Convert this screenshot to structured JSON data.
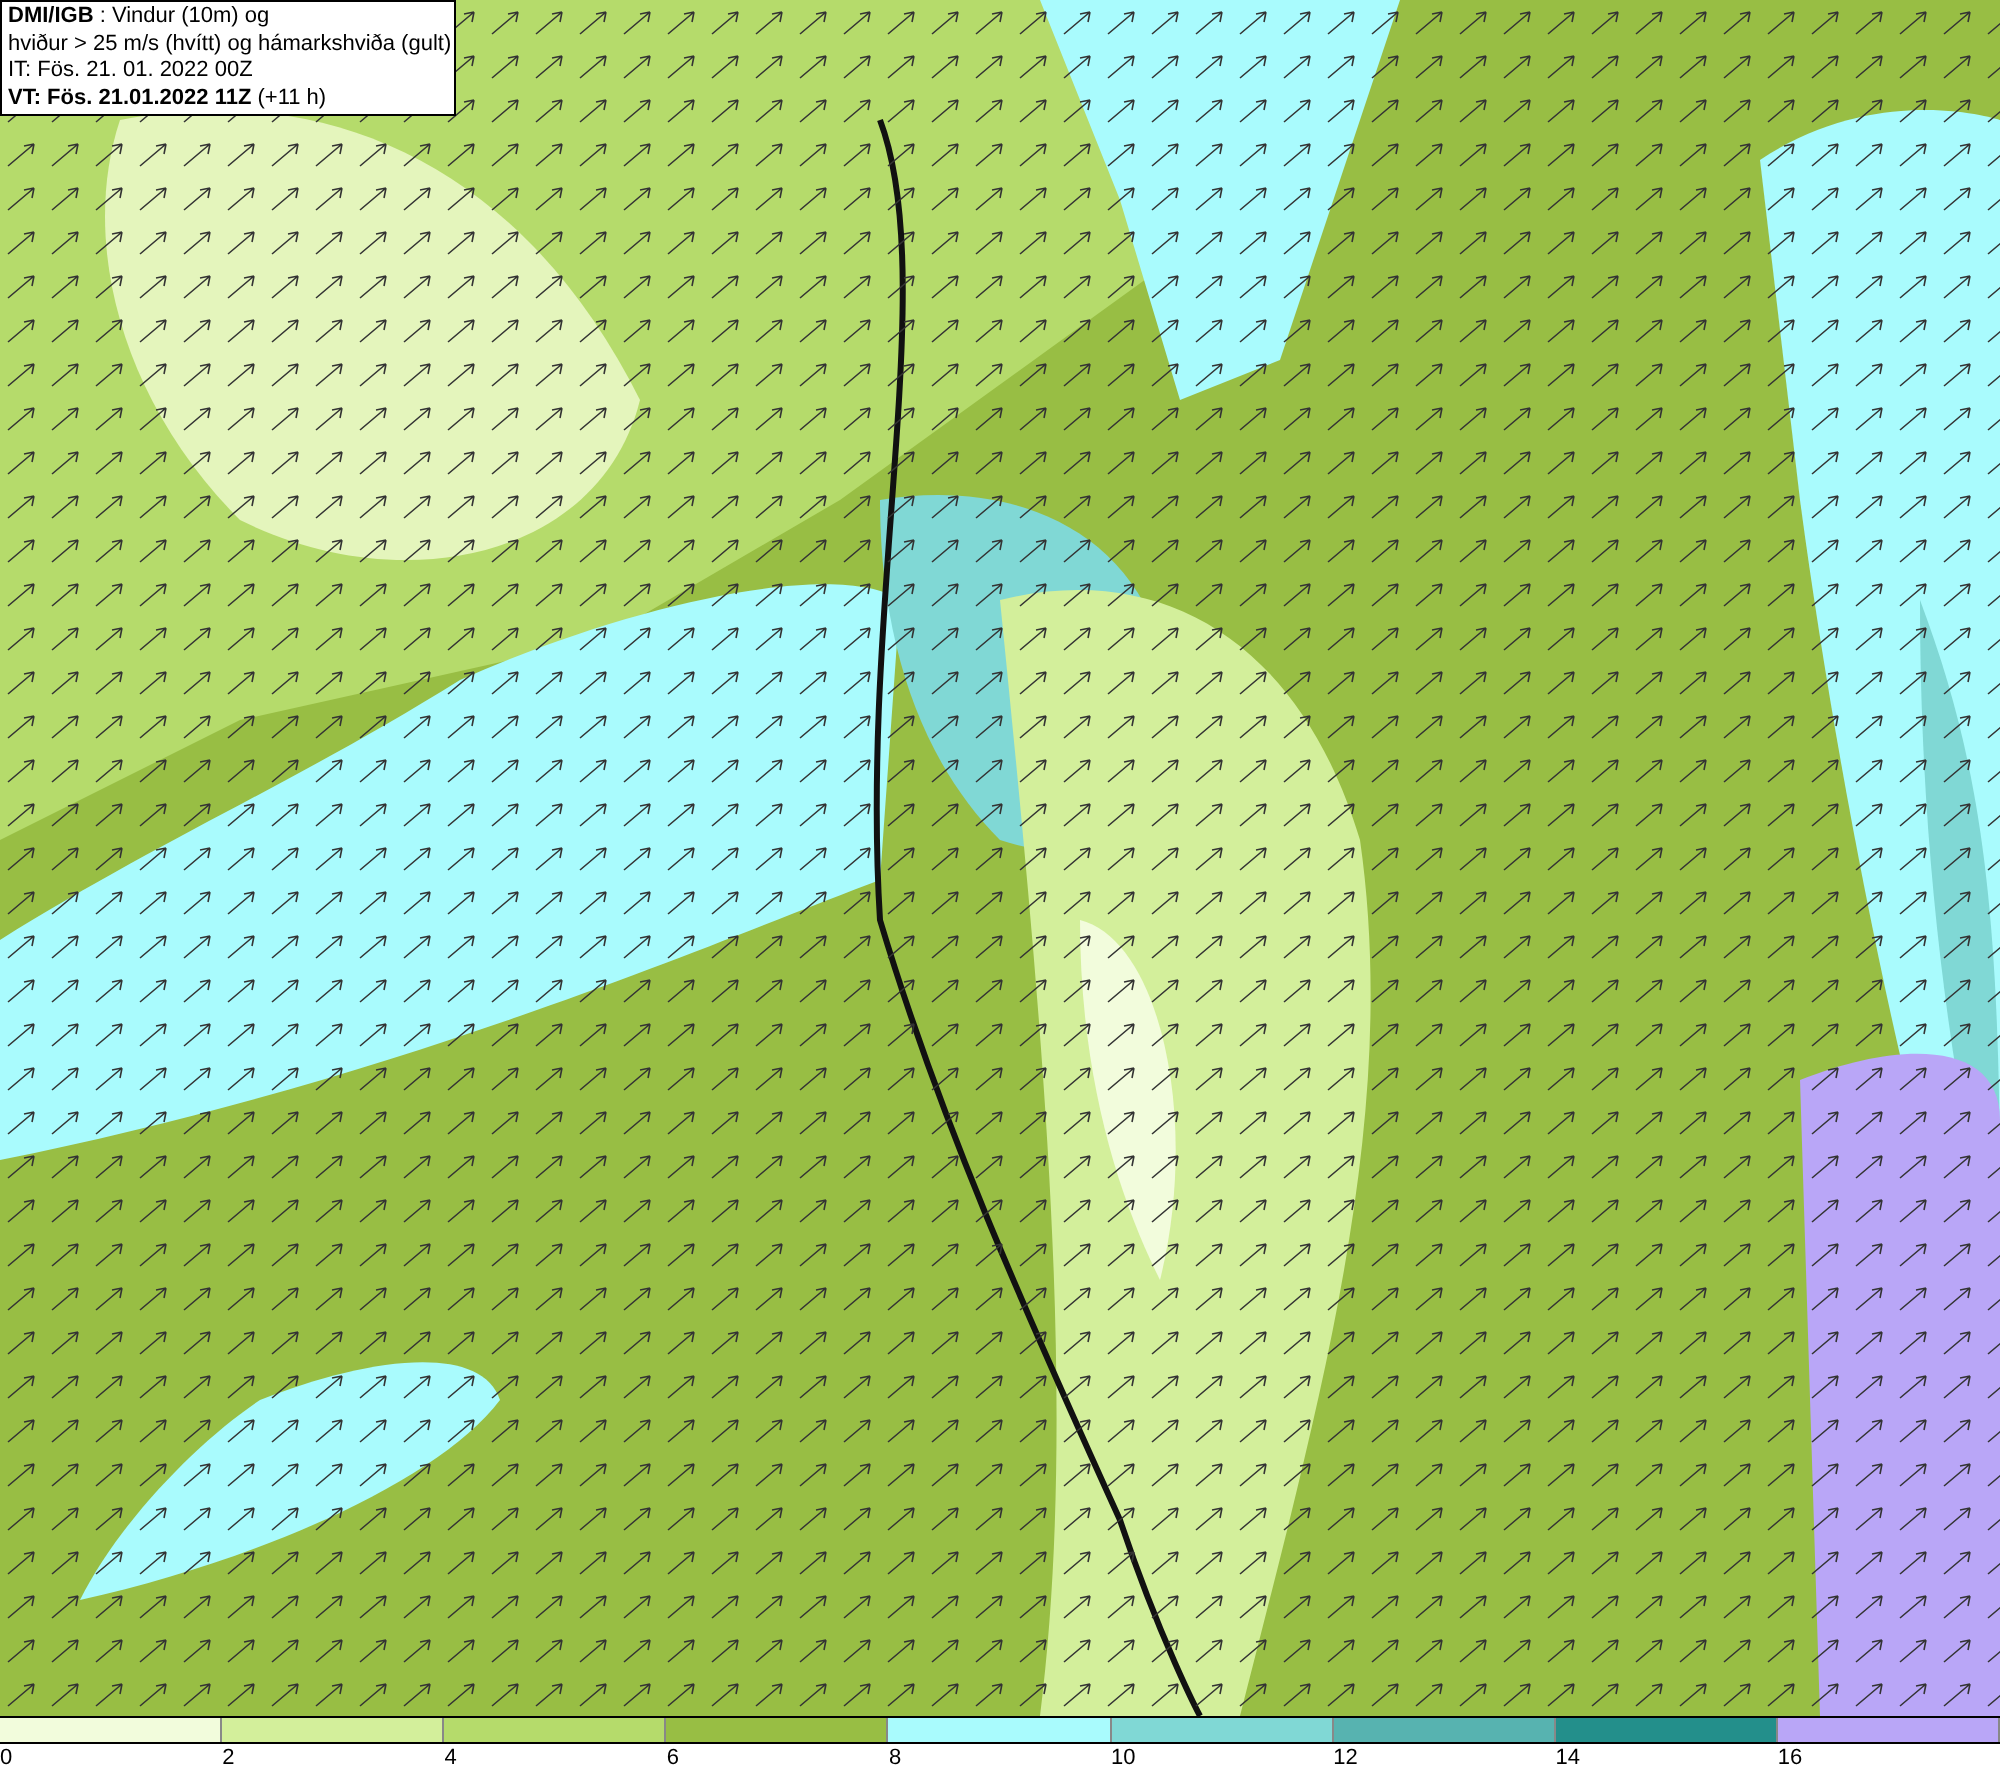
{
  "info_box": {
    "lines": [
      "**DMI/IGB** : Vindur (10m) og",
      "hviður > 25 m/s (hvítt) og hámarkshviða (gult)",
      "IT: Fös. 21. 01. 2022 00Z",
      "**VT: Fös. 21.01.2022 11Z** (+11 h)"
    ]
  },
  "legend": {
    "segments": [
      {
        "color": "#f2fcdc"
      },
      {
        "color": "#d3ef9b"
      },
      {
        "color": "#b5db6b"
      },
      {
        "color": "#98be44"
      },
      {
        "color": "#a9fbfd"
      },
      {
        "color": "#80d8d5"
      },
      {
        "color": "#57b3b0"
      },
      {
        "color": "#238f8b"
      },
      {
        "color": "#b9a6f7"
      }
    ],
    "labels": [
      "0",
      "2",
      "4",
      "6",
      "8",
      "10",
      "12",
      "14",
      "16"
    ]
  }
}
